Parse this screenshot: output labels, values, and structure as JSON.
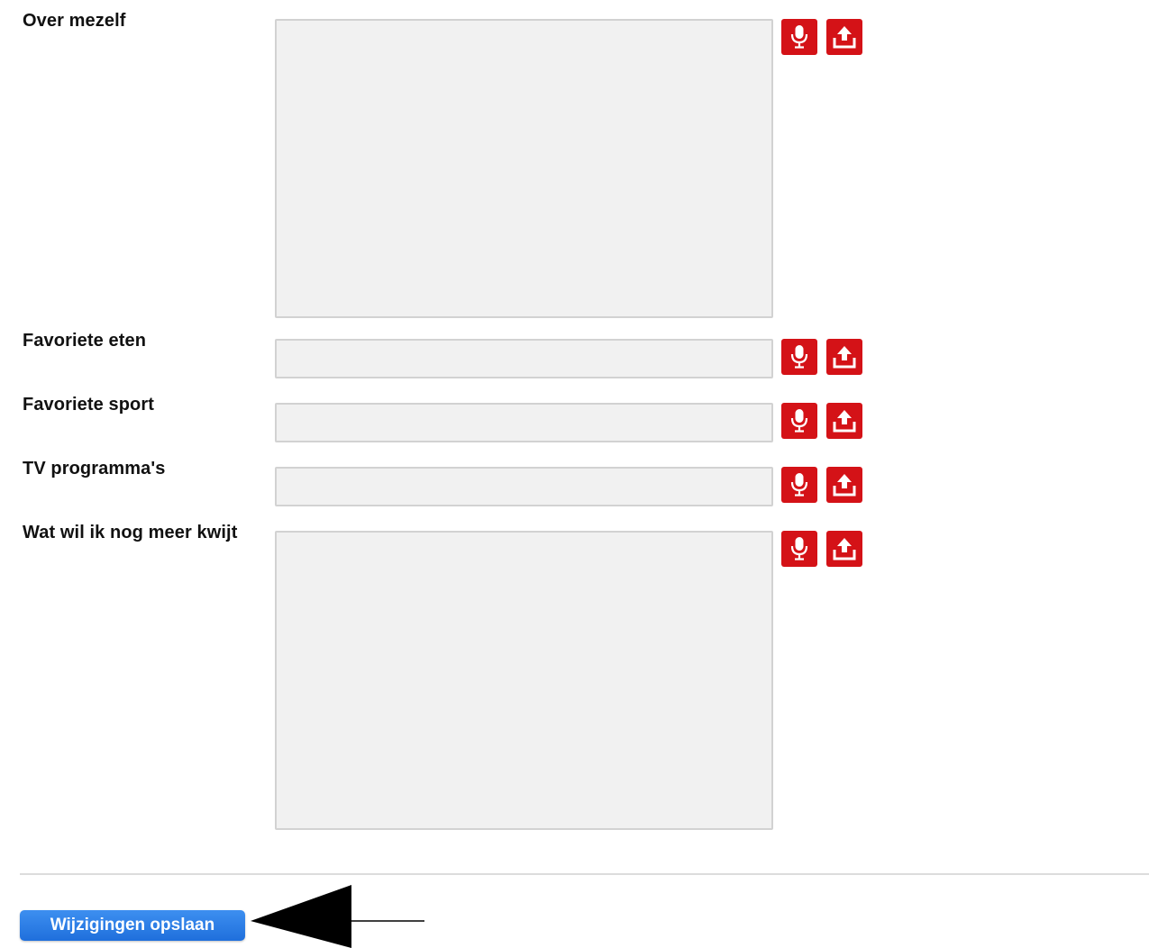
{
  "colors": {
    "accent_red": "#d41217",
    "field_background": "#f1f1f1",
    "save_button": "#2a7ce6"
  },
  "fields": [
    {
      "label": "Over mezelf",
      "type": "textarea",
      "value": ""
    },
    {
      "label": "Favoriete eten",
      "type": "input",
      "value": ""
    },
    {
      "label": "Favoriete sport",
      "type": "input",
      "value": ""
    },
    {
      "label": "TV programma's",
      "type": "input",
      "value": ""
    },
    {
      "label": "Wat wil ik nog meer kwijt",
      "type": "textarea",
      "value": ""
    }
  ],
  "field_icons": [
    "microphone-icon",
    "upload-icon"
  ],
  "save_button": {
    "label": "Wijzigingen opslaan"
  }
}
